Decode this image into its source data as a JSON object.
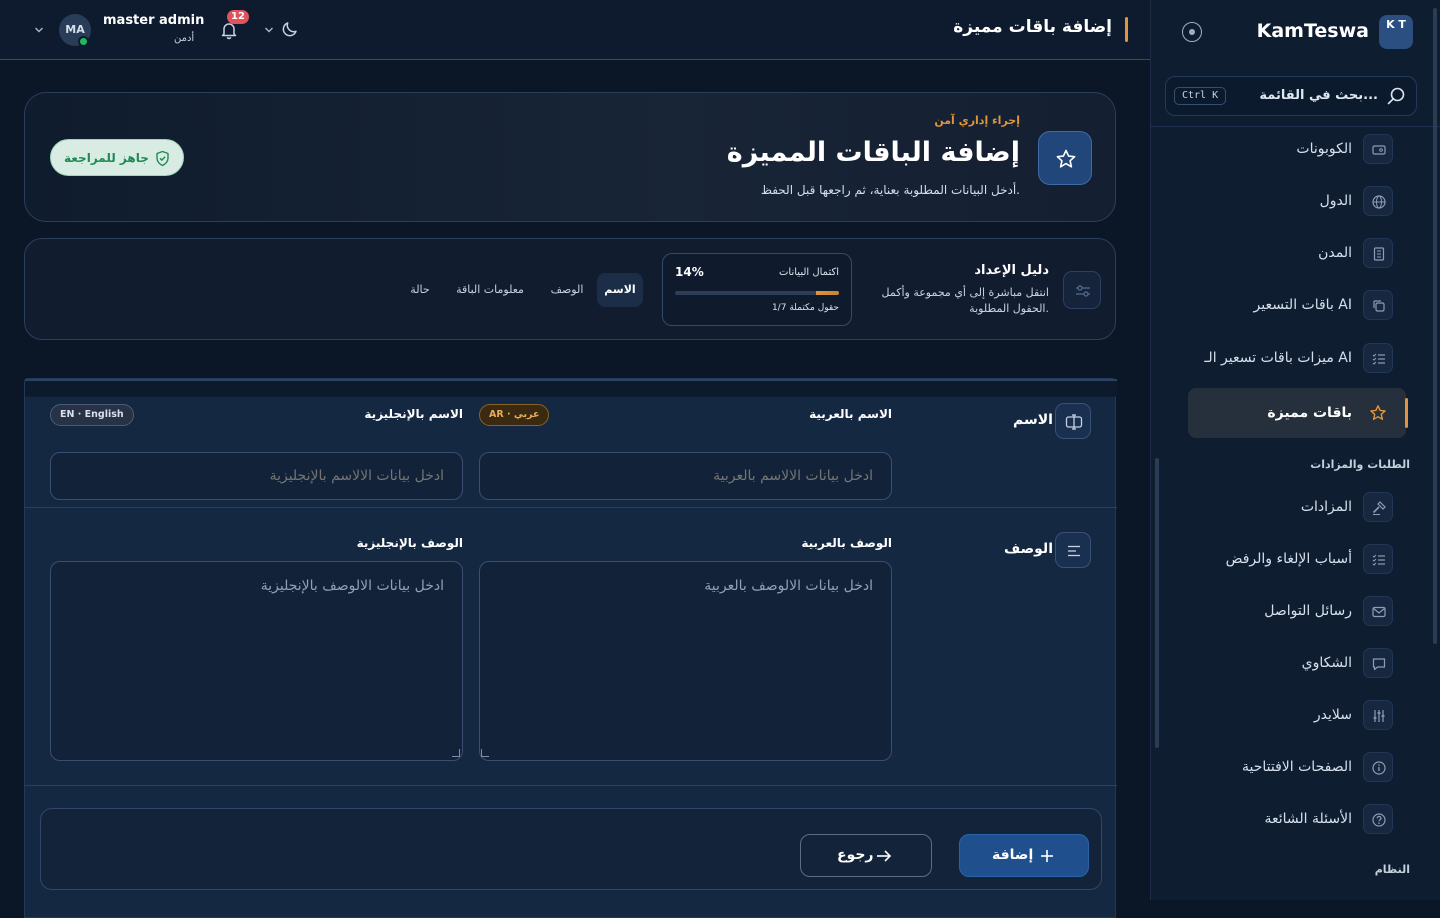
{
  "app": {
    "brand_name": "KamTeswa",
    "logo_text": "K T",
    "title": "إضافة باقات مميزة"
  },
  "user": {
    "initials": "MA",
    "name": "master admin",
    "role": "أدمن",
    "notifications": "12"
  },
  "sidebar": {
    "search_placeholder": "بحث في القائمة...",
    "search_shortcut": "Ctrl K",
    "items": [
      {
        "label": "الكوبونات",
        "icon": "ticket-icon"
      },
      {
        "label": "الدول",
        "icon": "globe-icon"
      },
      {
        "label": "المدن",
        "icon": "building-icon"
      },
      {
        "label": "باقات التسعير AI",
        "icon": "copy-icon"
      },
      {
        "label": "ميزات باقات تسعير الـ AI",
        "icon": "list-check-icon"
      },
      {
        "label": "باقات مميزة",
        "icon": "star-icon",
        "active": true
      }
    ],
    "group_orders": "الطلبات والمزادات",
    "orders_items": [
      {
        "label": "المزادات",
        "icon": "gavel-icon"
      },
      {
        "label": "أسباب الإلغاء والرفض",
        "icon": "list-check-icon"
      },
      {
        "label": "رسائل التواصل",
        "icon": "mail-icon"
      },
      {
        "label": "الشكاوي",
        "icon": "message-icon"
      },
      {
        "label": "سلايدر",
        "icon": "sliders-icon"
      },
      {
        "label": "الصفحات الافتتاحية",
        "icon": "info-icon"
      },
      {
        "label": "الأسئلة الشائعة",
        "icon": "help-icon"
      }
    ],
    "group_system": "النظام"
  },
  "hero": {
    "eyebrow": "إجراء إداري آمن",
    "title": "إضافة الباقات المميزة",
    "subtitle": "أدخل البيانات المطلوبة بعناية، ثم راجعها قبل الحفظ.",
    "ready_badge": "جاهز للمراجعة"
  },
  "guide": {
    "title": "دليل الإعداد",
    "subtitle": "انتقل مباشرة إلى أي مجموعة وأكمل الحقول المطلوبة.",
    "progress_label": "اكتمال البيانات",
    "progress_percent": "14%",
    "progress_value": 14,
    "progress_count": "1/7 حقول مكتملة",
    "tabs": [
      "الاسم",
      "الوصف",
      "معلومات الباقة",
      "حالة"
    ],
    "active_tab": 0
  },
  "form": {
    "name_section": {
      "title": "الاسم",
      "ar_label": "الاسم بالعربية",
      "ar_chip": "AR · عربي",
      "ar_placeholder": "ادخل بيانات الالاسم بالعربية",
      "en_label": "الاسم بالإنجليزية",
      "en_chip": "EN · English",
      "en_placeholder": "ادخل بيانات الالاسم بالإنجليزية"
    },
    "desc_section": {
      "title": "الوصف",
      "ar_label": "الوصف بالعربية",
      "ar_placeholder": "ادخل بيانات الالوصف بالعربية",
      "en_label": "الوصف بالإنجليزية",
      "en_placeholder": "ادخل بيانات الالوصف بالإنجليزية"
    },
    "add_button": "إضافة",
    "back_button": "رجوع"
  },
  "colors": {
    "accent": "#e0953a",
    "primary": "#1f4f8c",
    "success": "#1f8a55"
  }
}
